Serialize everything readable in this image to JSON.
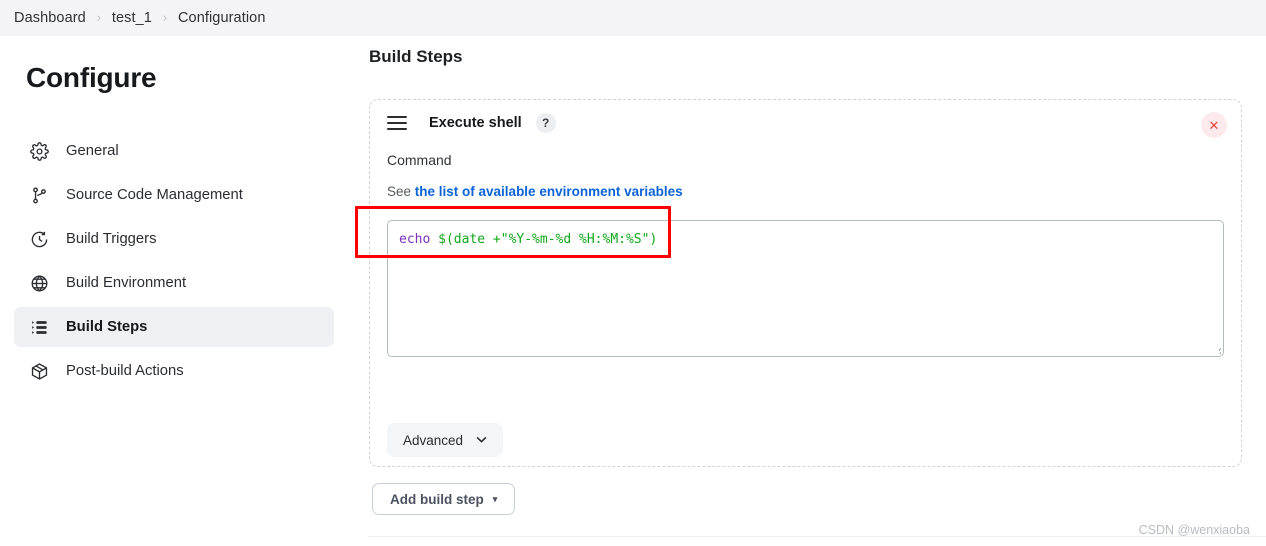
{
  "breadcrumb": {
    "items": [
      "Dashboard",
      "test_1",
      "Configuration"
    ],
    "separator": "›"
  },
  "sidebar": {
    "title": "Configure",
    "items": [
      {
        "label": "General",
        "icon": "gear-icon",
        "active": false
      },
      {
        "label": "Source Code Management",
        "icon": "git-branch-icon",
        "active": false
      },
      {
        "label": "Build Triggers",
        "icon": "clock-icon",
        "active": false
      },
      {
        "label": "Build Environment",
        "icon": "globe-icon",
        "active": false
      },
      {
        "label": "Build Steps",
        "icon": "list-icon",
        "active": true
      },
      {
        "label": "Post-build Actions",
        "icon": "package-icon",
        "active": false
      }
    ]
  },
  "main": {
    "section_title": "Build Steps",
    "build_step": {
      "title": "Execute shell",
      "help_badge": "?",
      "close_label": "✕",
      "command_label": "Command",
      "see_prefix": "See ",
      "see_link": "the list of available environment variables",
      "command_value": "echo $(date +\"%Y-%m-%d %H:%M:%S\")",
      "command_tokens": {
        "keyword": "echo",
        "rest": " $(date +\"%Y-%m-%d %H:%M:%S\")"
      },
      "advanced_label": "Advanced",
      "advanced_chevron": "⌄"
    },
    "add_build_step": {
      "label": "Add build step",
      "caret": "▾"
    }
  },
  "watermark": "CSDN @wenxiaoba",
  "colors": {
    "header_bg": "#f4f4f6",
    "link_blue": "#0b63d6",
    "annotation_red": "#fe0000",
    "close_red": "#e8453c",
    "code_keyword": "#7c2fbd",
    "code_string": "#0fa818",
    "active_nav_bg": "#eef0f3"
  }
}
